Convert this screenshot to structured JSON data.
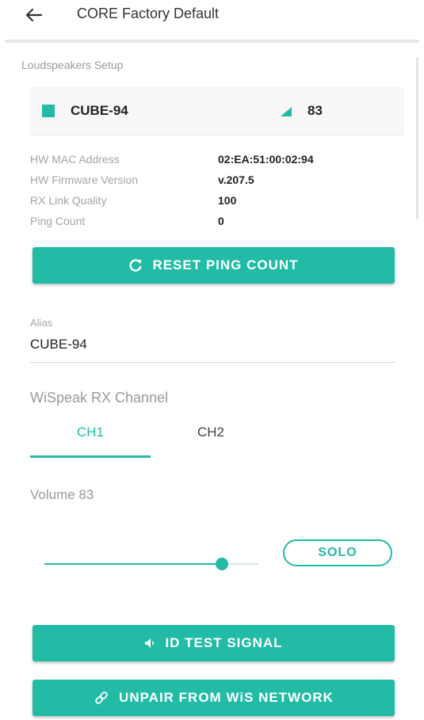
{
  "header": {
    "title": "CORE Factory Default"
  },
  "section": {
    "title": "Loudspeakers Setup"
  },
  "device": {
    "name": "CUBE-94",
    "signal": "83",
    "color": "#22bba6"
  },
  "info": [
    {
      "label": "HW MAC Address",
      "value": "02:EA:51:00:02:94"
    },
    {
      "label": "HW Firmware Version",
      "value": "v.207.5"
    },
    {
      "label": "RX Link Quality",
      "value": "100"
    },
    {
      "label": "Ping Count",
      "value": "0"
    }
  ],
  "buttons": {
    "reset_ping": "RESET PING COUNT",
    "id_test": "ID TEST SIGNAL",
    "unpair": "UNPAIR FROM WiS NETWORK"
  },
  "alias": {
    "label": "Alias",
    "value": "CUBE-94"
  },
  "channel": {
    "label": "WiSpeak RX Channel",
    "tabs": [
      {
        "label": "CH1",
        "selected": true
      },
      {
        "label": "CH2",
        "selected": false
      }
    ]
  },
  "volume": {
    "label": "Volume 83",
    "value": 83,
    "max": 100
  },
  "solo": {
    "label": "SOLO"
  },
  "theme": {
    "accent": "#22bba6"
  }
}
